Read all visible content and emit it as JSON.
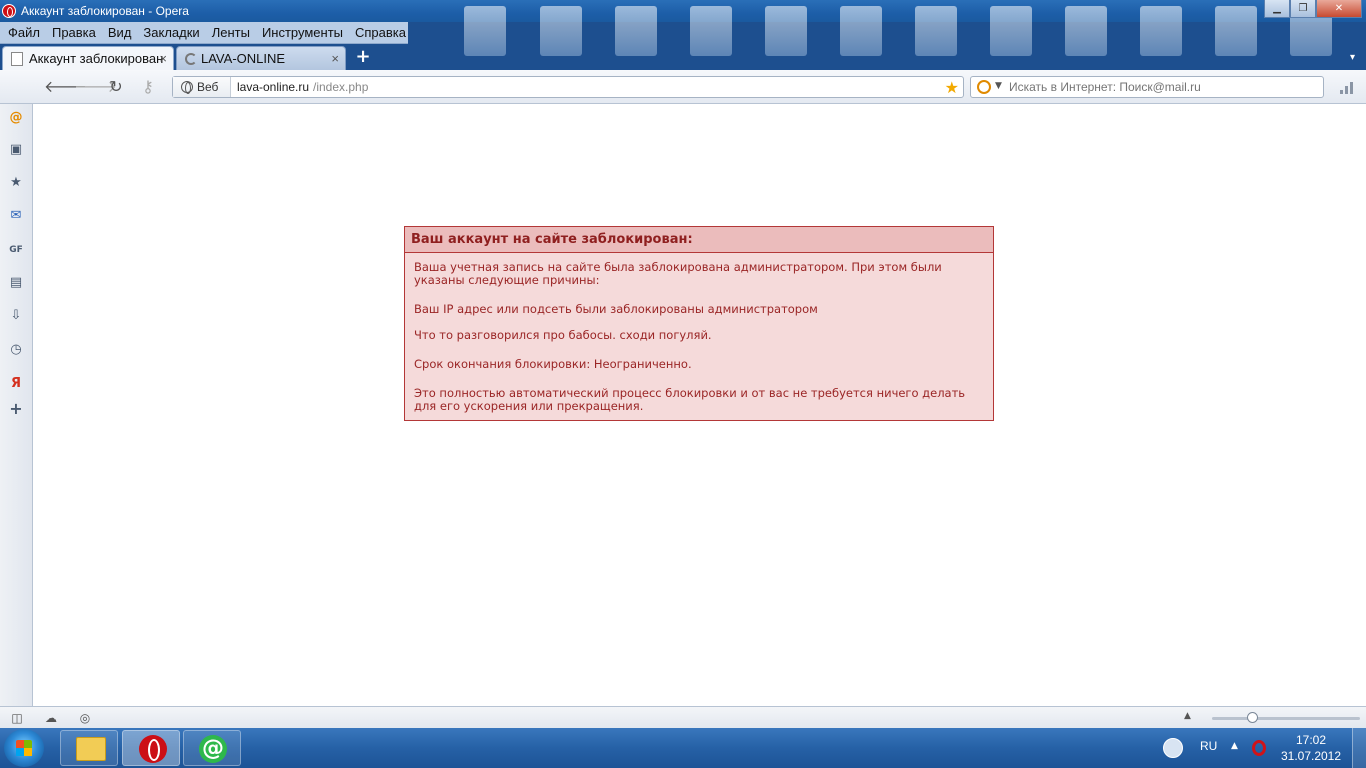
{
  "window": {
    "title": "Аккаунт заблокирован - Opera",
    "controls": {
      "minimize": "▁",
      "maximize": "❐",
      "close": "✕"
    }
  },
  "menu": [
    "Файл",
    "Правка",
    "Вид",
    "Закладки",
    "Ленты",
    "Инструменты",
    "Справка"
  ],
  "tabs": [
    {
      "label": "Аккаунт заблокирован",
      "close": "×",
      "state": "active"
    },
    {
      "label": "LAVA-ONLINE",
      "close": "×",
      "state": "loading"
    }
  ],
  "new_tab": "+",
  "address": {
    "badge": "Веб",
    "url_host": "lava-online.ru",
    "url_path": "/index.php"
  },
  "search": {
    "placeholder": "Искать в Интернет: Поиск@mail.ru"
  },
  "sidebar_icons": [
    "mail-ru-icon",
    "speed-dial-icon",
    "bookmarks-icon",
    "mail-icon",
    "feeds-icon",
    "notes-icon",
    "downloads-icon",
    "history-icon",
    "yandex-icon",
    "add-panel-icon"
  ],
  "block": {
    "header": "Ваш аккаунт на сайте заблокирован:",
    "intro": "Ваша учетная запись на сайте была заблокирована администратором. При этом были указаны следующие причины:",
    "reason_ip": "Ваш IP адрес или подсеть были заблокированы администратором",
    "reason_text": "Что то разговорился про бабосы. сходи погуляй.",
    "expiry": "Срок окончания блокировки: Неограниченно.",
    "auto_note": "Это полностью автоматический процесс блокировки и от вас не требуется ничего делать для его ускорения или прекращения."
  },
  "colors": {
    "block_background": "#f5dada",
    "block_header": "#ebbcbc",
    "block_border": "#b33737",
    "block_text": "#9a2525"
  },
  "taskbar": {
    "language": "RU",
    "time": "17:02",
    "date": "31.07.2012"
  }
}
